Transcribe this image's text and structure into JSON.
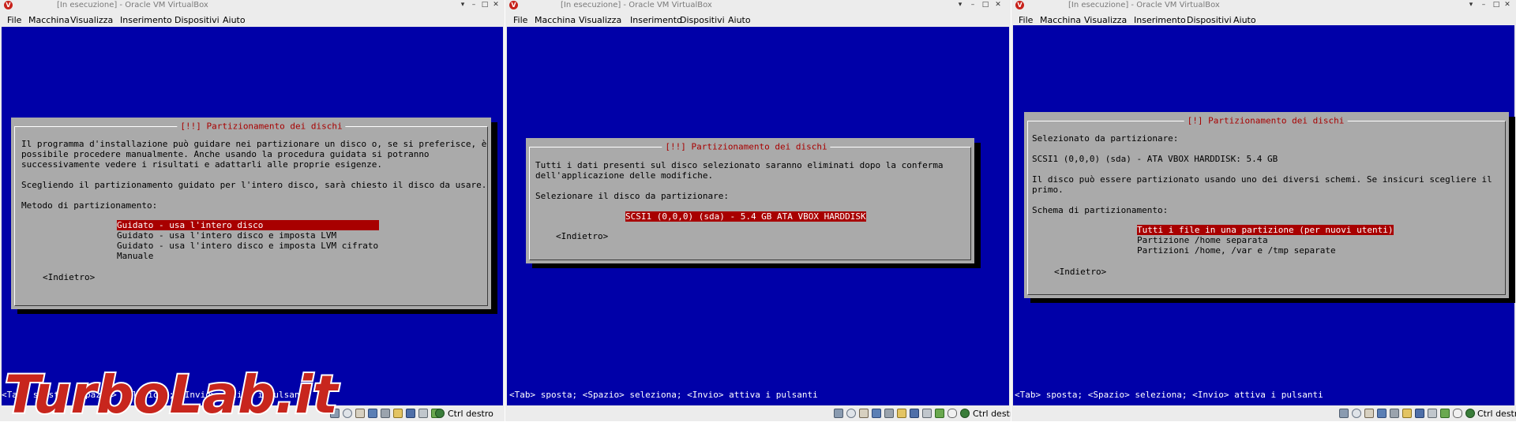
{
  "windows": [
    {
      "title": "[In esecuzione] - Oracle VM VirtualBox",
      "menu": [
        "File",
        "Macchina",
        "Visualizza",
        "Inserimento",
        "Dispositivi",
        "Aiuto"
      ],
      "dialog": {
        "title": "[!!] Partizionamento dei dischi",
        "lines": [
          "Il programma d'installazione può guidare nei partizionare un disco o, se si preferisce, è",
          "possibile procedere manualmente. Anche usando la procedura guidata si potranno",
          "successivamente vedere i risultati e adattarli alle proprie esigenze.",
          "",
          "Scegliendo il partizionamento guidato per l'intero disco, sarà chiesto il disco da usare.",
          "",
          "Metodo di partizionamento:"
        ],
        "options": [
          "Guidato - usa l'intero disco",
          "Guidato - usa l'intero disco e imposta LVM",
          "Guidato - usa l'intero disco e imposta LVM cifrato",
          "Manuale"
        ],
        "selected_index": 0,
        "back_button": "<Indietro>"
      },
      "hint": "<Tab> sposta; <Spazio> seleziona; <Invio> attiva i pulsanti",
      "host_key": "Ctrl destro"
    },
    {
      "title": "[In esecuzione] - Oracle VM VirtualBox",
      "menu": [
        "File",
        "Macchina",
        "Visualizza",
        "Inserimento",
        "Dispositivi",
        "Aiuto"
      ],
      "dialog": {
        "title": "[!!] Partizionamento dei dischi",
        "lines": [
          "Tutti i dati presenti sul disco selezionato saranno eliminati dopo la conferma",
          "dell'applicazione delle modifiche.",
          "",
          "Selezionare il disco da partizionare:"
        ],
        "options": [
          "SCSI1 (0,0,0) (sda) - 5.4 GB ATA VBOX HARDDISK"
        ],
        "selected_index": 0,
        "back_button": "<Indietro>"
      },
      "hint": "<Tab> sposta; <Spazio> seleziona; <Invio> attiva i pulsanti",
      "host_key": "Ctrl destro"
    },
    {
      "title": "[In esecuzione] - Oracle VM VirtualBox",
      "menu": [
        "File",
        "Macchina",
        "Visualizza",
        "Inserimento",
        "Dispositivi",
        "Aiuto"
      ],
      "dialog": {
        "title": "[!] Partizionamento dei dischi",
        "lines": [
          "Selezionato da partizionare:",
          "",
          "SCSI1 (0,0,0) (sda) - ATA VBOX HARDDISK: 5.4 GB",
          "",
          "Il disco può essere partizionato usando uno dei diversi schemi. Se insicuri scegliere il",
          "primo.",
          "",
          "Schema di partizionamento:"
        ],
        "options": [
          "Tutti i file in una partizione (per nuovi utenti)",
          "Partizione /home separata",
          "Partizioni /home, /var e /tmp separate"
        ],
        "selected_index": 0,
        "back_button": "<Indietro>"
      },
      "hint": "<Tab> sposta; <Spazio> seleziona; <Invio> attiva i pulsanti",
      "host_key": "Ctrl destro"
    }
  ],
  "status_icons": [
    "hard-disk-icon",
    "optical-drive-icon",
    "audio-icon",
    "network-icon",
    "usb-icon",
    "shared-folder-icon",
    "display-icon",
    "video-capture-icon",
    "cpu-icon",
    "mouse-integration-icon",
    "host-key-icon"
  ],
  "watermark": "TurboLab.it",
  "colors": {
    "screen": "#0000a8",
    "dialog": "#aaaaaa",
    "selection": "#a80000",
    "dialog_title": "#a80000",
    "chrome": "#ececec"
  }
}
